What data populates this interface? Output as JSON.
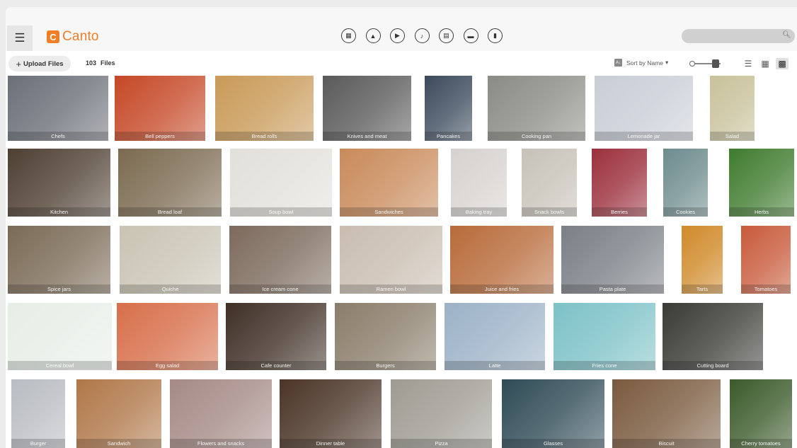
{
  "app": {
    "logo_text": "Canto",
    "logo_mark": "C",
    "brand_color": "#f07e26"
  },
  "header": {
    "menu_icon": "hamburger-menu-icon",
    "type_filters": [
      {
        "name": "all-files",
        "icon": "all-files-icon",
        "glyph": "▦"
      },
      {
        "name": "images",
        "icon": "image-icon",
        "glyph": "▲"
      },
      {
        "name": "video",
        "icon": "video-play-icon",
        "glyph": "▶"
      },
      {
        "name": "audio",
        "icon": "music-note-icon",
        "glyph": "♪"
      },
      {
        "name": "documents",
        "icon": "document-icon",
        "glyph": "▤"
      },
      {
        "name": "presentations",
        "icon": "presentation-icon",
        "glyph": "▬"
      },
      {
        "name": "other",
        "icon": "file-icon",
        "glyph": "▮"
      }
    ],
    "search": {
      "value": "",
      "placeholder": ""
    }
  },
  "toolbar": {
    "upload_label": "Upload Files",
    "file_count": "103",
    "file_count_label": "Files",
    "sort_label": "Sort by Name",
    "sort_arrow": "▾",
    "views": [
      {
        "name": "list-view",
        "glyph": "☰",
        "active": false
      },
      {
        "name": "grid-view",
        "glyph": "▦",
        "active": false
      },
      {
        "name": "large-grid-view",
        "glyph": "▩",
        "active": true
      }
    ]
  },
  "thumbnails": [
    {
      "row": 1,
      "subject": "Chefs",
      "color": "#6b6f78"
    },
    {
      "row": 1,
      "subject": "Bell peppers",
      "color": "#c54826"
    },
    {
      "row": 1,
      "subject": "Bread rolls",
      "color": "#c99a58"
    },
    {
      "row": 1,
      "subject": "Knives and meat",
      "color": "#5a5a5a"
    },
    {
      "row": 1,
      "subject": "Pancakes",
      "color": "#3b4a5c"
    },
    {
      "row": 1,
      "subject": "Cooking pan",
      "color": "#8b8b86"
    },
    {
      "row": 1,
      "subject": "Lemonade jar",
      "color": "#c9cdd6"
    },
    {
      "row": 1,
      "subject": "Salad",
      "color": "#c8c19a"
    },
    {
      "row": 2,
      "subject": "Kitchen",
      "color": "#4e3f32"
    },
    {
      "row": 2,
      "subject": "Bread loaf",
      "color": "#7b6a50"
    },
    {
      "row": 2,
      "subject": "Soup bowl",
      "color": "#e2e0da"
    },
    {
      "row": 2,
      "subject": "Sandwiches",
      "color": "#c98a5a"
    },
    {
      "row": 2,
      "subject": "Baking tray",
      "color": "#d6d2cf"
    },
    {
      "row": 2,
      "subject": "Snack bowls",
      "color": "#c7c2b8"
    },
    {
      "row": 2,
      "subject": "Berries",
      "color": "#9b2f3c"
    },
    {
      "row": 2,
      "subject": "Cookies",
      "color": "#6e8c8e"
    },
    {
      "row": 2,
      "subject": "Herbs",
      "color": "#3f7b2e"
    },
    {
      "row": 3,
      "subject": "Spice jars",
      "color": "#7a6a55"
    },
    {
      "row": 3,
      "subject": "Quiche",
      "color": "#c9c3b3"
    },
    {
      "row": 3,
      "subject": "Ice cream cone",
      "color": "#7c6a5c"
    },
    {
      "row": 3,
      "subject": "Ramen bowl",
      "color": "#c9bdb0"
    },
    {
      "row": 3,
      "subject": "Juice and fries",
      "color": "#b86b3a"
    },
    {
      "row": 3,
      "subject": "Pasta plate",
      "color": "#7b7f86"
    },
    {
      "row": 3,
      "subject": "Tarts",
      "color": "#d08a2a"
    },
    {
      "row": 3,
      "subject": "Tomatoes",
      "color": "#c85a3a"
    },
    {
      "row": 4,
      "subject": "Cereal bowl",
      "color": "#e6eee7"
    },
    {
      "row": 4,
      "subject": "Egg salad",
      "color": "#d76f4a"
    },
    {
      "row": 4,
      "subject": "Cafe counter",
      "color": "#3f2f26"
    },
    {
      "row": 4,
      "subject": "Burgers",
      "color": "#8a7d6a"
    },
    {
      "row": 4,
      "subject": "Latte",
      "color": "#9cb2c7"
    },
    {
      "row": 4,
      "subject": "Fries cone",
      "color": "#7dc2c7"
    },
    {
      "row": 4,
      "subject": "Cutting board",
      "color": "#3a3a36"
    },
    {
      "row": 5,
      "subject": "Burger",
      "color": "#b9bcc2"
    },
    {
      "row": 5,
      "subject": "Sandwich",
      "color": "#b07748"
    },
    {
      "row": 5,
      "subject": "Flowers and snacks",
      "color": "#a58a86"
    },
    {
      "row": 5,
      "subject": "Dinner table",
      "color": "#4a3426"
    },
    {
      "row": 5,
      "subject": "Pizza",
      "color": "#9e9b92"
    },
    {
      "row": 5,
      "subject": "Glasses",
      "color": "#2f4b56"
    },
    {
      "row": 5,
      "subject": "Biscuit",
      "color": "#7a5a3e"
    },
    {
      "row": 5,
      "subject": "Cherry tomatoes",
      "color": "#3b5a2a"
    }
  ]
}
